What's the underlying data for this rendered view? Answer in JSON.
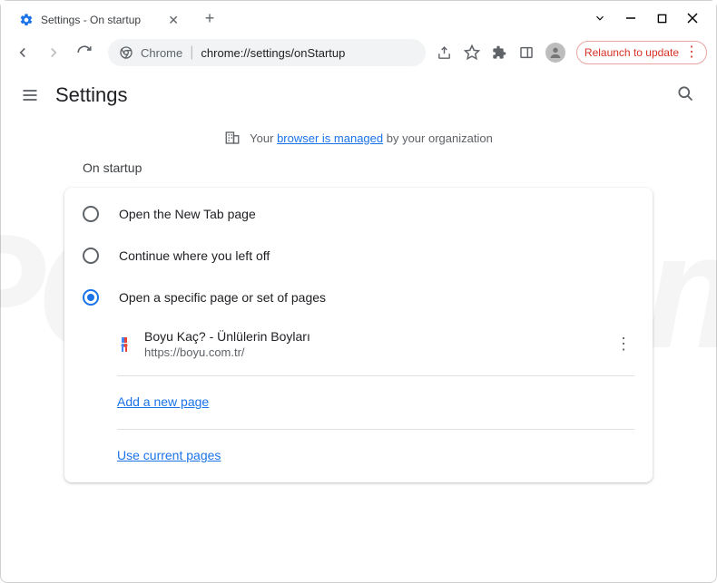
{
  "tab": {
    "title": "Settings - On startup"
  },
  "omnibox": {
    "prefix": "Chrome",
    "url": "chrome://settings/onStartup"
  },
  "relaunch": {
    "label": "Relaunch to update"
  },
  "header": {
    "title": "Settings"
  },
  "managed": {
    "prefix": "Your ",
    "link": "browser is managed",
    "suffix": " by your organization"
  },
  "section": {
    "title": "On startup"
  },
  "options": {
    "newtab": "Open the New Tab page",
    "continue": "Continue where you left off",
    "specific": "Open a specific page or set of pages"
  },
  "pages": [
    {
      "title": "Boyu Kaç? - Ünlülerin Boyları",
      "url": "https://boyu.com.tr/"
    }
  ],
  "links": {
    "add": "Add a new page",
    "current": "Use current pages"
  }
}
